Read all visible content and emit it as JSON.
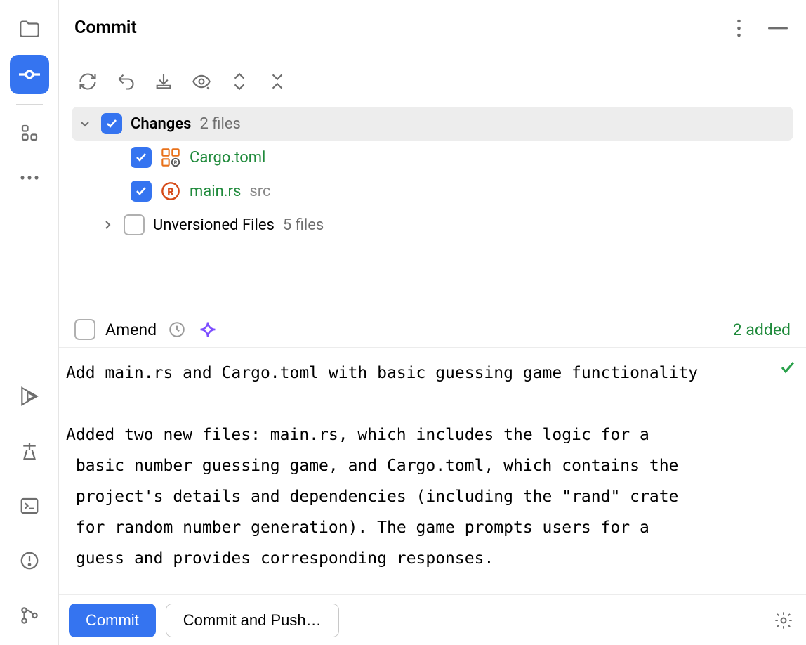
{
  "header": {
    "title": "Commit"
  },
  "tree": {
    "changes_group": {
      "label": "Changes",
      "count": "2 files",
      "checked": true,
      "expanded": true
    },
    "files": [
      {
        "name": "Cargo.toml",
        "path": "",
        "icon": "cargo-icon",
        "checked": true
      },
      {
        "name": "main.rs",
        "path": "src",
        "icon": "rust-icon",
        "checked": true
      }
    ],
    "unversioned_group": {
      "label": "Unversioned Files",
      "count": "5 files",
      "checked": false,
      "expanded": false
    }
  },
  "amend": {
    "label": "Amend"
  },
  "status": {
    "added": "2 added"
  },
  "commit_message": "Add main.rs and Cargo.toml with basic guessing game functionality\n\nAdded two new files: main.rs, which includes the logic for a\n basic number guessing game, and Cargo.toml, which contains the\n project's details and dependencies (including the \"rand\" crate\n for random number generation). The game prompts users for a\n guess and provides corresponding responses.",
  "footer": {
    "commit_label": "Commit",
    "commit_push_label": "Commit and Push…"
  }
}
